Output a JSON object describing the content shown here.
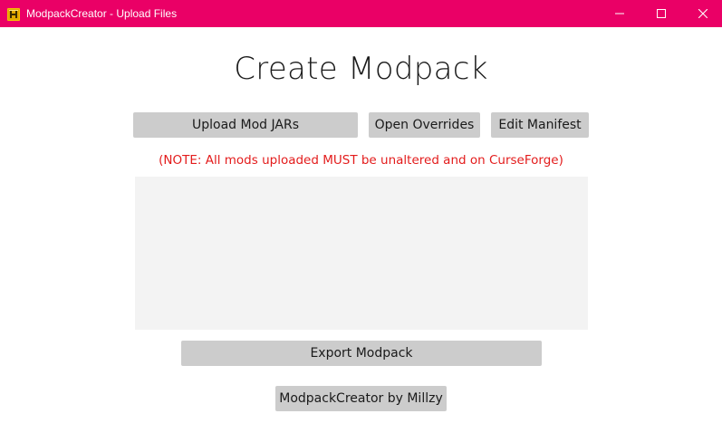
{
  "window": {
    "title": "ModpackCreator - Upload Files",
    "titlebar_color": "#ea0066",
    "icon": "app-icon",
    "controls": {
      "minimize_icon": "minimize-icon",
      "maximize_icon": "maximize-icon",
      "close_icon": "close-icon"
    }
  },
  "main": {
    "heading": "Create Modpack",
    "buttons": {
      "upload_label": "Upload Mod JARs",
      "overrides_label": "Open Overrides",
      "manifest_label": "Edit Manifest",
      "export_label": "Export Modpack",
      "credit_label": "ModpackCreator by Millzy"
    },
    "note": "(NOTE: All mods uploaded MUST be unaltered and on CurseForge)",
    "note_color": "#e31c1c",
    "file_list": []
  }
}
